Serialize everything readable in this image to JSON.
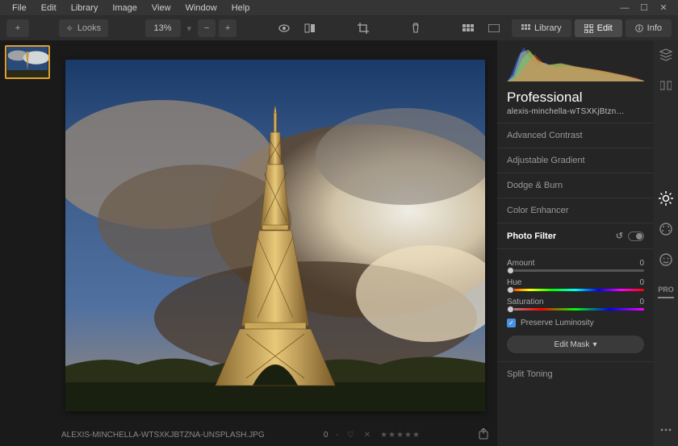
{
  "menubar": {
    "items": [
      "File",
      "Edit",
      "Library",
      "Image",
      "View",
      "Window",
      "Help"
    ]
  },
  "toolbar": {
    "looks_label": "Looks",
    "zoom_value": "13%",
    "tabs": {
      "library": "Library",
      "edit": "Edit",
      "info": "Info"
    }
  },
  "panel": {
    "title": "Professional",
    "subtitle": "alexis-minchella-wTSXKjBtzn…",
    "items": [
      "Advanced Contrast",
      "Adjustable Gradient",
      "Dodge & Burn",
      "Color Enhancer"
    ],
    "active_filter": "Photo Filter",
    "sliders": [
      {
        "label": "Amount",
        "value": "0",
        "track": "gray"
      },
      {
        "label": "Hue",
        "value": "0",
        "track": "hue"
      },
      {
        "label": "Saturation",
        "value": "0",
        "track": "sat"
      }
    ],
    "checkbox_label": "Preserve Luminosity",
    "mask_label": "Edit Mask",
    "after_items": [
      "Split Toning"
    ]
  },
  "status": {
    "filename": "ALEXIS-MINCHELLA-WTSXKJBTZNA-UNSPLASH.JPG",
    "rating_prefix": "0"
  },
  "rail": {
    "pro_label": "PRO"
  }
}
